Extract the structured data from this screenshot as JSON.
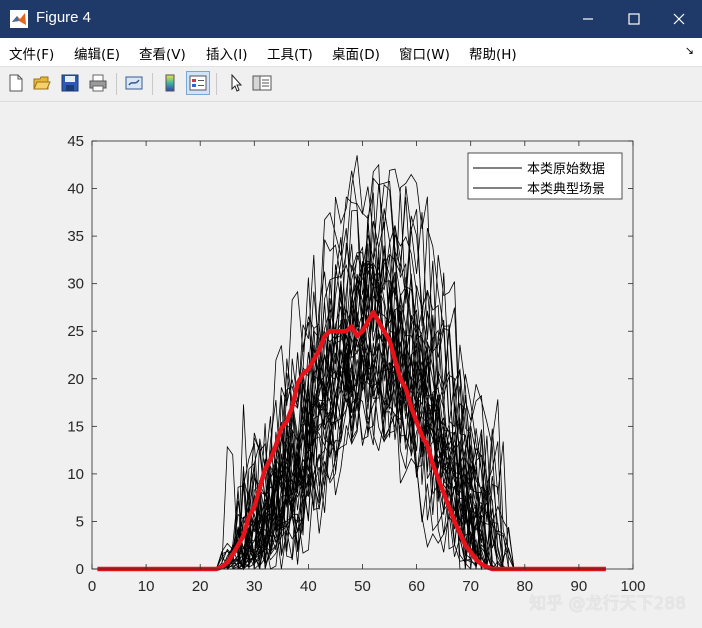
{
  "window": {
    "title": "Figure 4",
    "controls": {
      "minimize_icon": "minimize-icon",
      "maximize_icon": "maximize-icon",
      "close_icon": "close-icon"
    }
  },
  "menubar": {
    "items": [
      {
        "label": "文件(F)"
      },
      {
        "label": "编辑(E)"
      },
      {
        "label": "查看(V)"
      },
      {
        "label": "插入(I)"
      },
      {
        "label": "工具(T)"
      },
      {
        "label": "桌面(D)"
      },
      {
        "label": "窗口(W)"
      },
      {
        "label": "帮助(H)"
      }
    ],
    "overflow_glyph": "↘"
  },
  "toolbar": {
    "buttons": [
      "new-figure-icon",
      "open-file-icon",
      "save-icon",
      "print-icon",
      "link-plot-icon",
      "insert-colorbar-icon",
      "insert-legend-icon",
      "edit-plot-cursor-icon",
      "property-inspector-icon"
    ],
    "active": "insert-legend-icon"
  },
  "watermark": "知乎 @龙行天下288",
  "colors": {
    "raw": "#000000",
    "typical": "#e8131a",
    "titlebar": "#1f3a68"
  },
  "chart_data": {
    "type": "line",
    "xlim": [
      0,
      100
    ],
    "ylim": [
      0,
      45
    ],
    "xticks": [
      "0",
      "10",
      "20",
      "30",
      "40",
      "50",
      "60",
      "70",
      "80",
      "90",
      "100"
    ],
    "yticks": [
      "0",
      "5",
      "10",
      "15",
      "20",
      "25",
      "30",
      "35",
      "40",
      "45"
    ],
    "legend": {
      "position": "top-right",
      "entries": [
        "本类原始数据",
        "本类典型场景"
      ]
    },
    "raw_series_count": 40,
    "raw_series_peak_mean": 27,
    "raw_series_peak_max": 43.5,
    "raw_series_x_range": [
      23,
      78
    ],
    "typical_scenario": {
      "name": "本类典型场景",
      "x": [
        1,
        23,
        24,
        25,
        26,
        27,
        28,
        29,
        30,
        31,
        32,
        33,
        34,
        35,
        36,
        37,
        38,
        39,
        40,
        41,
        42,
        43,
        44,
        45,
        46,
        47,
        48,
        49,
        50,
        51,
        52,
        53,
        54,
        55,
        56,
        57,
        58,
        59,
        60,
        61,
        62,
        63,
        64,
        65,
        66,
        67,
        68,
        69,
        70,
        71,
        72,
        73,
        74,
        75,
        76,
        77,
        78,
        95
      ],
      "y": [
        0,
        0,
        0.2,
        0.7,
        1.5,
        2.5,
        3.5,
        5.5,
        6.5,
        8.5,
        10.5,
        11.5,
        13,
        14.8,
        15.5,
        17,
        19.5,
        20.5,
        21,
        22,
        23,
        24.5,
        25,
        25,
        25,
        25,
        25.5,
        24.5,
        25,
        26,
        27,
        26,
        25,
        24,
        22,
        20,
        19,
        17,
        15.5,
        14,
        13,
        11,
        9.5,
        8,
        6.5,
        5,
        3.8,
        2.5,
        1.8,
        1,
        0.5,
        0.2,
        0,
        0,
        0,
        0,
        0,
        0
      ]
    }
  }
}
